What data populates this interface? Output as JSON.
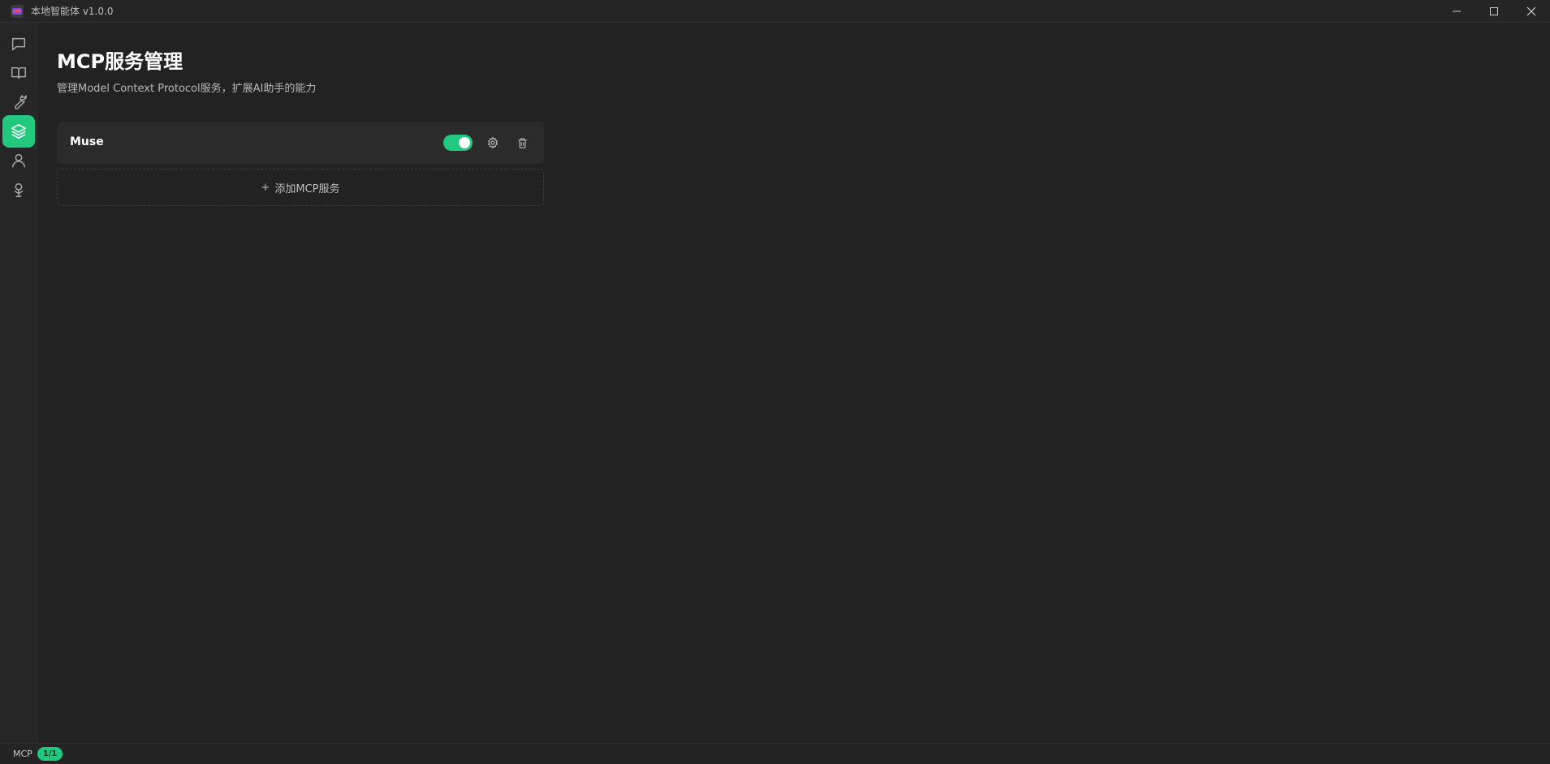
{
  "window": {
    "title": "本地智能体 v1.0.0",
    "controls": [
      {
        "name": "minimize-icon"
      },
      {
        "name": "maximize-icon"
      },
      {
        "name": "close-icon"
      }
    ]
  },
  "sidebar": {
    "items": [
      {
        "icon": "chat-icon",
        "active": false
      },
      {
        "icon": "book-icon",
        "active": false
      },
      {
        "icon": "wrench-icon",
        "active": false
      },
      {
        "icon": "layers-icon",
        "active": true
      },
      {
        "icon": "user-icon",
        "active": false
      },
      {
        "icon": "debug-icon",
        "active": false
      }
    ]
  },
  "main": {
    "title": "MCP服务管理",
    "description": "管理Model Context Protocol服务，扩展AI助手的能力",
    "services": [
      {
        "name": "Muse",
        "enabled": true
      }
    ],
    "add_button": {
      "plus": "+",
      "label": "添加MCP服务"
    }
  },
  "statusbar": {
    "label": "MCP",
    "badge": "1/1"
  },
  "colors": {
    "accent": "#21c97e",
    "background": "#222222",
    "card": "#2b2b2b"
  }
}
